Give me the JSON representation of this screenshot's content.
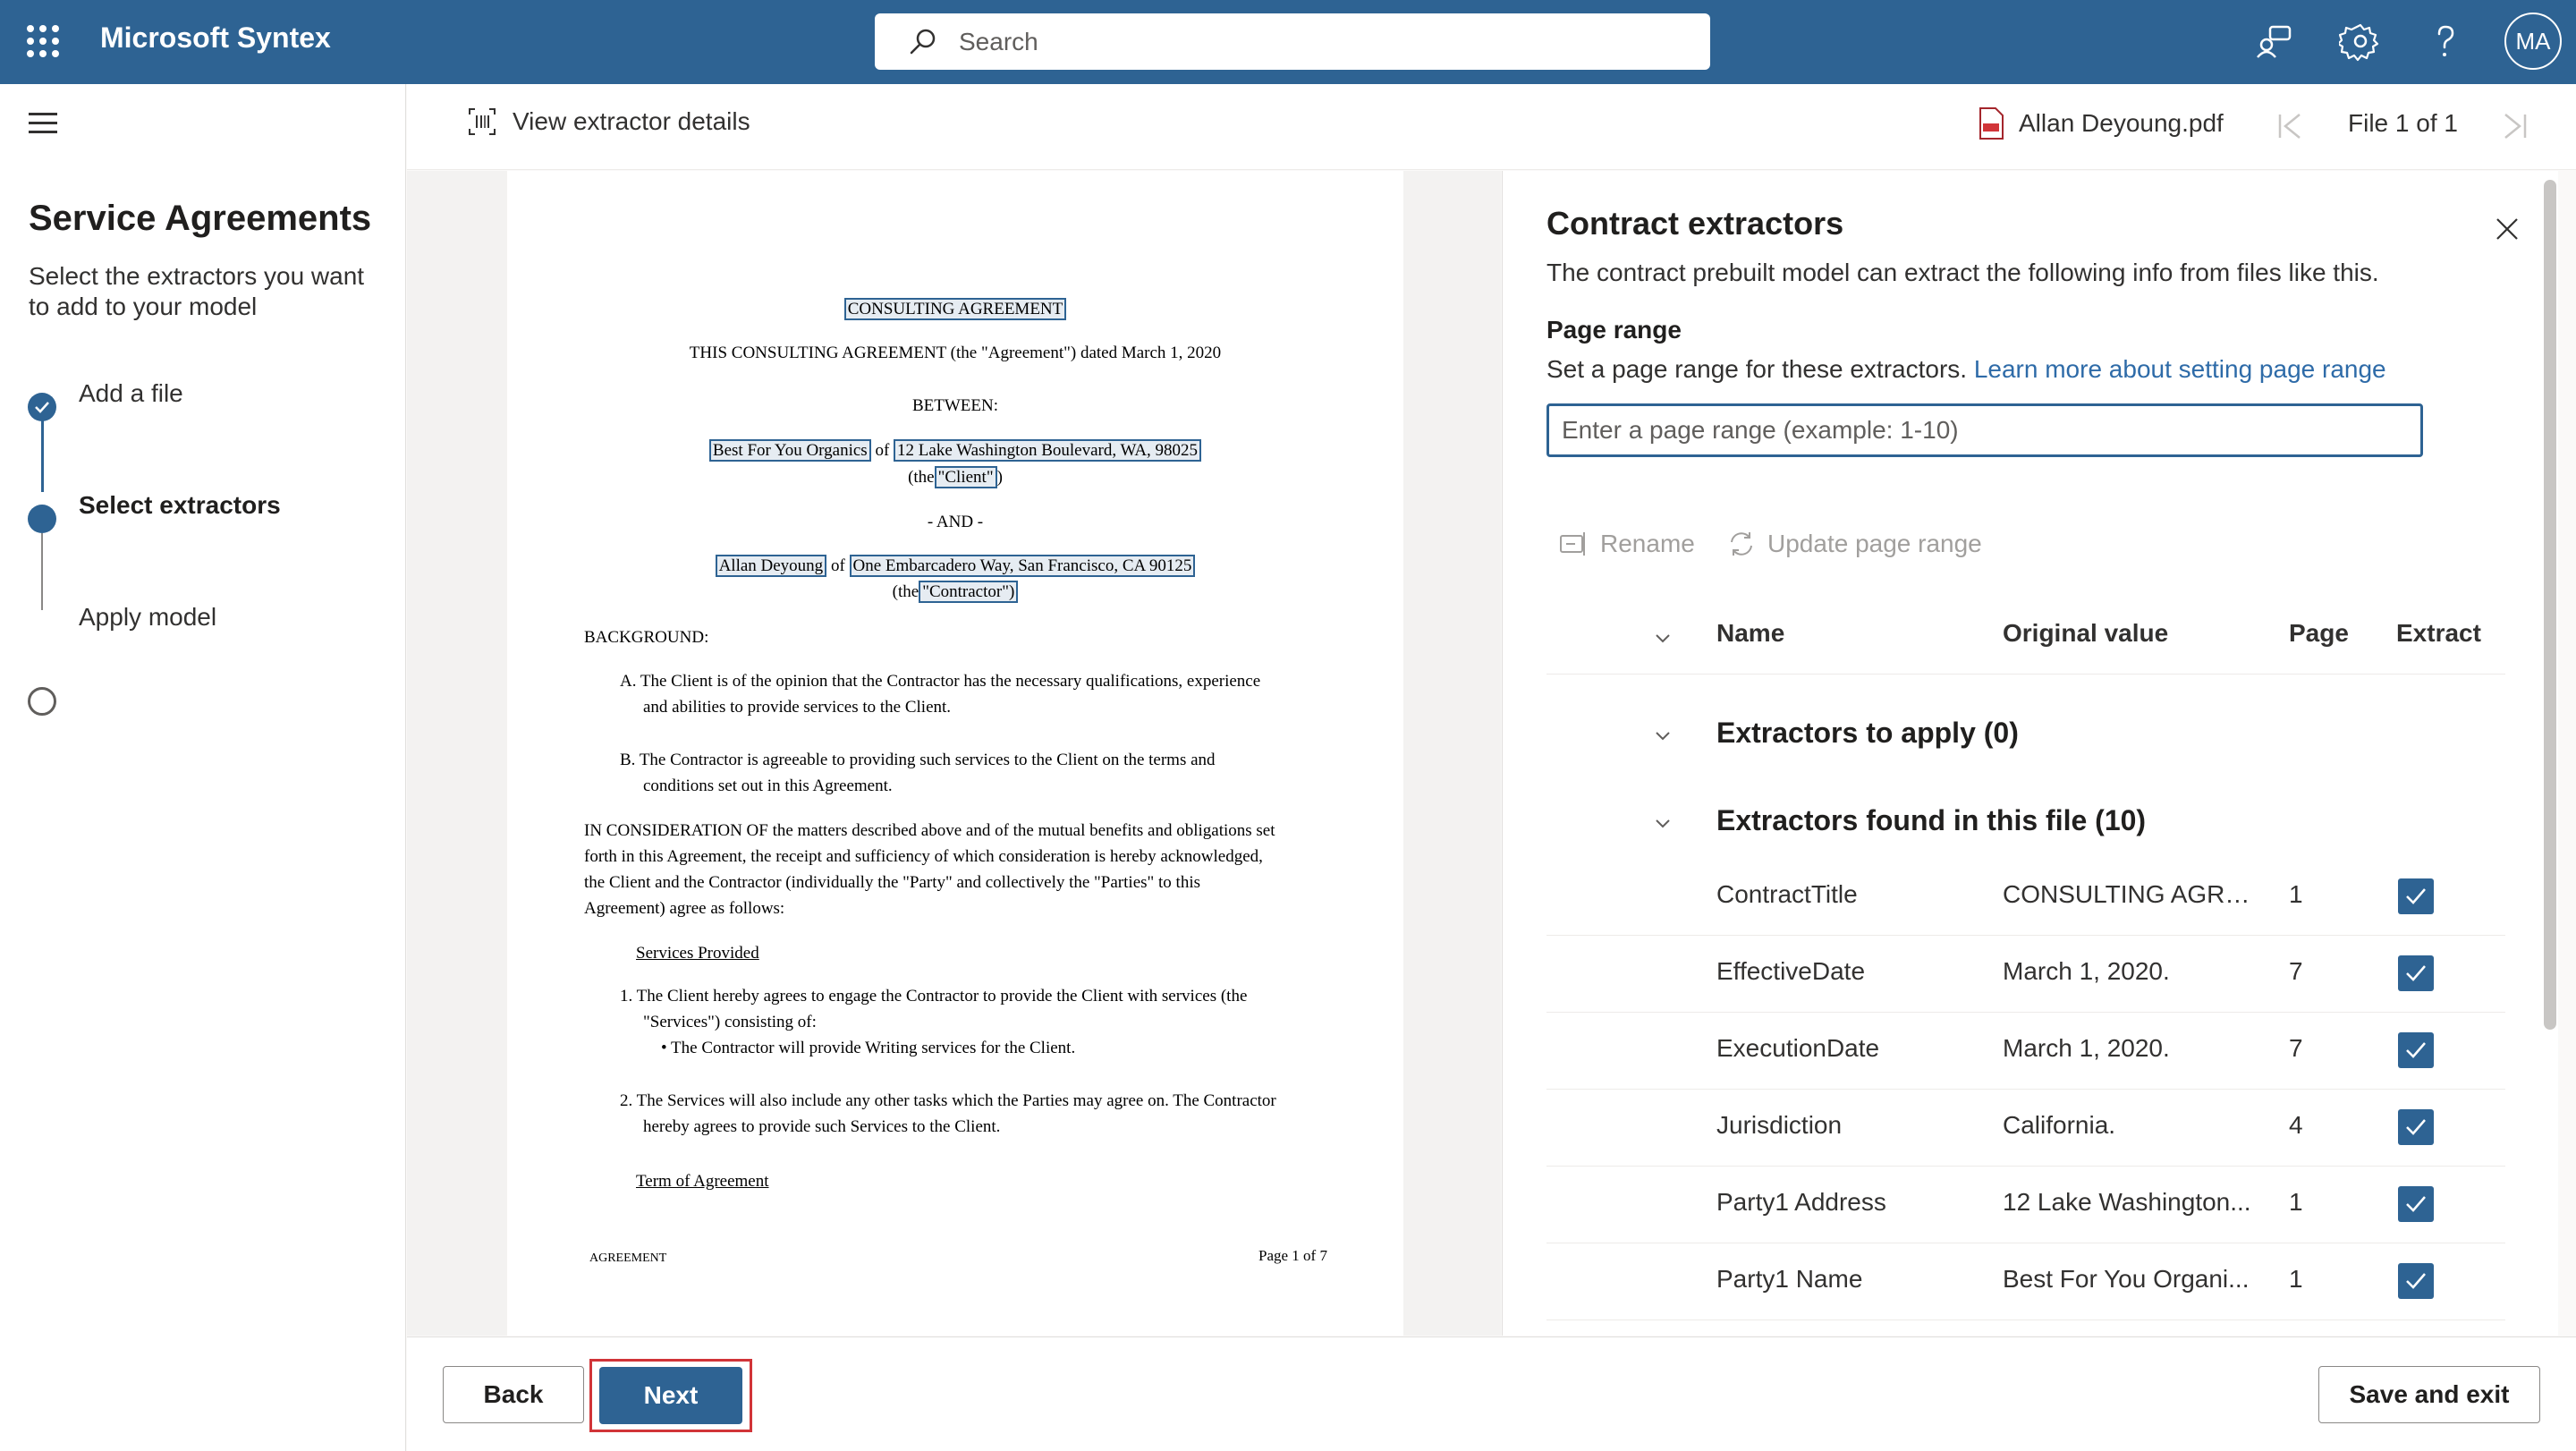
{
  "app": {
    "name": "Microsoft Syntex"
  },
  "search": {
    "placeholder": "Search"
  },
  "topbar": {
    "avatar": "MA"
  },
  "left": {
    "title": "Service Agreements",
    "subtitle": "Select the extractors you want to add to your model",
    "steps": [
      {
        "label": "Add a file",
        "state": "done"
      },
      {
        "label": "Select extractors",
        "state": "current"
      },
      {
        "label": "Apply model",
        "state": "pending"
      }
    ]
  },
  "subheader": {
    "view_details": "View extractor details",
    "file_name": "Allan Deyoung.pdf",
    "file_count": "File 1 of 1"
  },
  "document": {
    "title": "CONSULTING AGREEMENT",
    "line1": "THIS CONSULTING AGREEMENT (the \"Agreement\")  dated March 1, 2020",
    "between": "BETWEEN:",
    "party1_name": "Best For You Organics",
    "of": "of",
    "party1_address": "12 Lake Washington Boulevard,  WA, 98025",
    "the_open": "(the",
    "client_label": "\"Client\"",
    "close_paren": ")",
    "and": "- AND -",
    "party2_name": "Allan Deyoung",
    "party2_address": "One Embarcadero Way, San Francisco, CA 90125",
    "contractor_label": "\"Contractor\")",
    "background": "BACKGROUND:",
    "bgA_1": "A.  The Client is of the opinion that the Contractor has the necessary qualifications, experience",
    "bgA_2": "and abilities to provide services to the Client.",
    "bgB_1": "B.  The Contractor is agreeable to providing such services to the Client on the terms and",
    "bgB_2": "conditions set out in this Agreement.",
    "consid_1": "IN CONSIDERATION OF the matters described above and of the mutual benefits and obligations set",
    "consid_2": "forth in this Agreement, the receipt and sufficiency of which consideration is hereby acknowledged,",
    "consid_3": "the Client and the Contractor (individually the \"Party\" and collectively the \"Parties\" to this",
    "consid_4": "Agreement) agree as follows:",
    "services_heading": "Services Provided",
    "s1_1": "1.  The Client hereby agrees to engage the Contractor to provide the Client with services (the",
    "s1_2": "\"Services\") consisting of:",
    "s1_bullet": "•  The Contractor will provide Writing services for the Client.",
    "s2_1": "2.  The Services will also include any other tasks which the Parties may agree on. The Contractor",
    "s2_2": "hereby agrees to provide such Services to the Client.",
    "term_heading": "Term of Agreement",
    "footer_left": "AGREEMENT",
    "footer_right": "Page 1 of 7"
  },
  "panel": {
    "title": "Contract extractors",
    "description": "The contract prebuilt model can extract the following info from files like this.",
    "page_range_label": "Page range",
    "page_range_desc": "Set a page range for these extractors.",
    "learn_more": "Learn more about setting page range",
    "page_range_placeholder": "Enter a page range (example: 1-10)",
    "rename": "Rename",
    "update_range": "Update page range",
    "columns": {
      "name": "Name",
      "original": "Original value",
      "page": "Page",
      "extract": "Extract"
    },
    "group_apply": "Extractors to apply (0)",
    "group_found": "Extractors found in this file (10)",
    "rows": [
      {
        "name": "ContractTitle",
        "original": "CONSULTING AGRE...",
        "page": "1",
        "extract": true
      },
      {
        "name": "EffectiveDate",
        "original": "March 1, 2020.",
        "page": "7",
        "extract": true
      },
      {
        "name": "ExecutionDate",
        "original": "March 1, 2020.",
        "page": "7",
        "extract": true
      },
      {
        "name": "Jurisdiction",
        "original": "California.",
        "page": "4",
        "extract": true
      },
      {
        "name": "Party1 Address",
        "original": "12 Lake Washington...",
        "page": "1",
        "extract": true
      },
      {
        "name": "Party1 Name",
        "original": "Best For You Organi...",
        "page": "1",
        "extract": true
      }
    ]
  },
  "footer": {
    "back": "Back",
    "next": "Next",
    "save_exit": "Save and exit"
  },
  "colors": {
    "brand": "#2e6393",
    "highlight_outline": "#d13438"
  }
}
